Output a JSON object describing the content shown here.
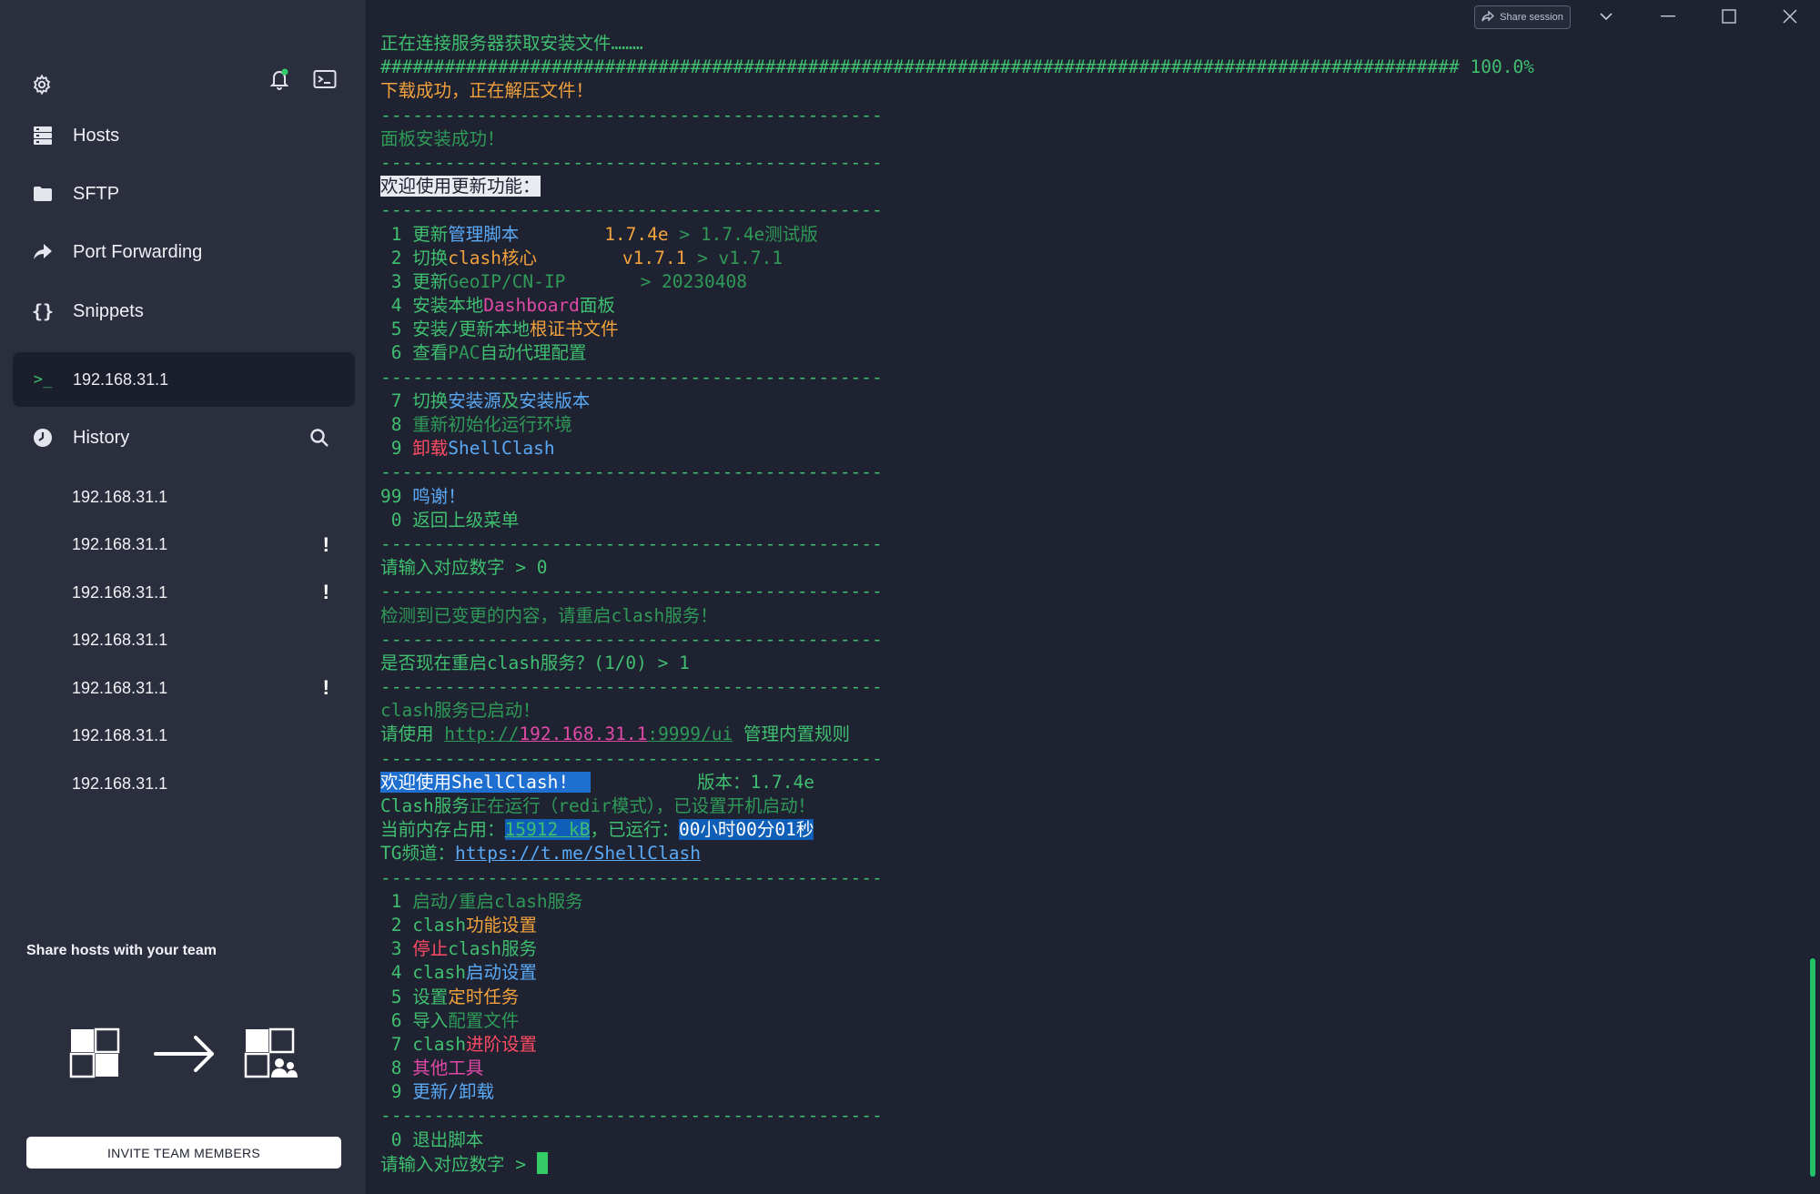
{
  "sidebar": {
    "nav": [
      {
        "label": "Hosts",
        "icon": "hosts-icon"
      },
      {
        "label": "SFTP",
        "icon": "folder-icon"
      },
      {
        "label": "Port Forwarding",
        "icon": "port-forward-icon"
      },
      {
        "label": "Snippets",
        "icon": "braces-icon"
      }
    ],
    "active_session": "192.168.31.1",
    "history_label": "History",
    "history": [
      {
        "host": "192.168.31.1",
        "warn": ""
      },
      {
        "host": "192.168.31.1",
        "warn": "!"
      },
      {
        "host": "192.168.31.1",
        "warn": "!"
      },
      {
        "host": "192.168.31.1",
        "warn": ""
      },
      {
        "host": "192.168.31.1",
        "warn": "!"
      },
      {
        "host": "192.168.31.1",
        "warn": ""
      },
      {
        "host": "192.168.31.1",
        "warn": ""
      }
    ],
    "promo_title": "Share hosts with your team",
    "invite_label": "INVITE TEAM MEMBERS"
  },
  "titlebar": {
    "share_label": "Share session"
  },
  "terminal": {
    "lines": [
      [
        {
          "t": "正在连接服务器获取安装文件………",
          "c": "g"
        }
      ],
      [
        {
          "t": "##################################################################################################### 100.0%",
          "c": "g"
        }
      ],
      [
        {
          "t": "下载成功，正在解压文件！",
          "c": "o"
        }
      ],
      [
        {
          "t": "-----------------------------------------------",
          "c": "g"
        }
      ],
      [
        {
          "t": "面板安装成功！",
          "c": "gd"
        }
      ],
      [
        {
          "t": "-----------------------------------------------",
          "c": "g"
        }
      ],
      [
        {
          "t": "欢迎使用更新功能：",
          "c": "hlw"
        }
      ],
      [
        {
          "t": "-----------------------------------------------",
          "c": "g"
        }
      ],
      [
        {
          "t": " 1 ",
          "c": "g"
        },
        {
          "t": "更新",
          "c": "g"
        },
        {
          "t": "管理脚本",
          "c": "b"
        },
        {
          "t": "        ",
          "c": "g"
        },
        {
          "t": "1.7.4e",
          "c": "o"
        },
        {
          "t": " > 1.7.4e测试版",
          "c": "gd"
        }
      ],
      [
        {
          "t": " 2 ",
          "c": "g"
        },
        {
          "t": "切换",
          "c": "g"
        },
        {
          "t": "clash核心",
          "c": "o"
        },
        {
          "t": "        ",
          "c": "g"
        },
        {
          "t": "v1.7.1",
          "c": "o"
        },
        {
          "t": " > v1.7.1",
          "c": "gd"
        }
      ],
      [
        {
          "t": " 3 ",
          "c": "g"
        },
        {
          "t": "更新",
          "c": "g"
        },
        {
          "t": "GeoIP/CN-IP",
          "c": "gd"
        },
        {
          "t": "       > 20230408",
          "c": "gd"
        }
      ],
      [
        {
          "t": " 4 ",
          "c": "g"
        },
        {
          "t": "安装本地",
          "c": "g"
        },
        {
          "t": "Dashboard",
          "c": "m"
        },
        {
          "t": "面板",
          "c": "g"
        }
      ],
      [
        {
          "t": " 5 ",
          "c": "g"
        },
        {
          "t": "安装/更新本地",
          "c": "g"
        },
        {
          "t": "根证书文件",
          "c": "o"
        }
      ],
      [
        {
          "t": " 6 ",
          "c": "g"
        },
        {
          "t": "查看",
          "c": "g"
        },
        {
          "t": "PAC",
          "c": "gd"
        },
        {
          "t": "自动代理配置",
          "c": "g"
        }
      ],
      [
        {
          "t": "-----------------------------------------------",
          "c": "g"
        }
      ],
      [
        {
          "t": " 7 ",
          "c": "g"
        },
        {
          "t": "切换",
          "c": "g"
        },
        {
          "t": "安装源",
          "c": "b"
        },
        {
          "t": "及",
          "c": "g"
        },
        {
          "t": "安装版本",
          "c": "b"
        }
      ],
      [
        {
          "t": " 8 ",
          "c": "g"
        },
        {
          "t": "重新初始化运行环境",
          "c": "gd"
        }
      ],
      [
        {
          "t": " 9 ",
          "c": "g"
        },
        {
          "t": "卸载",
          "c": "r"
        },
        {
          "t": "ShellClash",
          "c": "b"
        }
      ],
      [
        {
          "t": "-----------------------------------------------",
          "c": "g"
        }
      ],
      [
        {
          "t": "99 ",
          "c": "g"
        },
        {
          "t": "鸣谢！",
          "c": "b"
        }
      ],
      [
        {
          "t": " 0 ",
          "c": "g"
        },
        {
          "t": "返回上级菜单",
          "c": "g"
        }
      ],
      [
        {
          "t": "-----------------------------------------------",
          "c": "g"
        }
      ],
      [
        {
          "t": "请输入对应数字 > 0",
          "c": "g"
        }
      ],
      [
        {
          "t": "-----------------------------------------------",
          "c": "g"
        }
      ],
      [
        {
          "t": "检测到已变更的内容，请重启clash服务！",
          "c": "gd"
        }
      ],
      [
        {
          "t": "-----------------------------------------------",
          "c": "g"
        }
      ],
      [
        {
          "t": "是否现在重启clash服务？(1/0) > 1",
          "c": "g"
        }
      ],
      [
        {
          "t": "-----------------------------------------------",
          "c": "g"
        }
      ],
      [
        {
          "t": "clash服务已启动！",
          "c": "gd"
        }
      ],
      [
        {
          "t": "请使用 ",
          "c": "g"
        },
        {
          "t": "http://",
          "c": "gd u"
        },
        {
          "t": "192.168.31.1",
          "c": "m u"
        },
        {
          "t": ":9999/ui",
          "c": "gd u"
        },
        {
          "t": " 管理内置规则",
          "c": "g"
        }
      ],
      [
        {
          "t": "-----------------------------------------------",
          "c": "g"
        }
      ],
      [
        {
          "t": "欢迎使用ShellClash!  ",
          "c": "hlb"
        },
        {
          "t": "          版本：1.7.4e",
          "c": "g"
        }
      ],
      [
        {
          "t": "Clash服务",
          "c": "g"
        },
        {
          "t": "正在运行（redir模式）",
          "c": "gd"
        },
        {
          "t": "，已设置开机启动！",
          "c": "gd"
        }
      ],
      [
        {
          "t": "当前内存占用：",
          "c": "g"
        },
        {
          "t": "15912 kB",
          "c": "hlg"
        },
        {
          "t": "，已运行：",
          "c": "g"
        },
        {
          "t": "00小时00分01秒",
          "c": "hlb2"
        }
      ],
      [
        {
          "t": "TG频道：",
          "c": "g"
        },
        {
          "t": "https://t.me/ShellClash",
          "c": "b u"
        }
      ],
      [
        {
          "t": "-----------------------------------------------",
          "c": "g"
        }
      ],
      [
        {
          "t": " 1 ",
          "c": "g"
        },
        {
          "t": "启动/重启clash服务",
          "c": "gd"
        }
      ],
      [
        {
          "t": " 2 ",
          "c": "g"
        },
        {
          "t": "clash",
          "c": "g"
        },
        {
          "t": "功能设置",
          "c": "o"
        }
      ],
      [
        {
          "t": " 3 ",
          "c": "g"
        },
        {
          "t": "停止",
          "c": "r"
        },
        {
          "t": "clash服务",
          "c": "g"
        }
      ],
      [
        {
          "t": " 4 ",
          "c": "g"
        },
        {
          "t": "clash",
          "c": "g"
        },
        {
          "t": "启动设置",
          "c": "b"
        }
      ],
      [
        {
          "t": " 5 ",
          "c": "g"
        },
        {
          "t": "设置",
          "c": "g"
        },
        {
          "t": "定时任务",
          "c": "o"
        }
      ],
      [
        {
          "t": " 6 ",
          "c": "g"
        },
        {
          "t": "导入",
          "c": "g"
        },
        {
          "t": "配置文件",
          "c": "gd"
        }
      ],
      [
        {
          "t": " 7 ",
          "c": "g"
        },
        {
          "t": "clash",
          "c": "g"
        },
        {
          "t": "进阶设置",
          "c": "r"
        }
      ],
      [
        {
          "t": " 8 ",
          "c": "g"
        },
        {
          "t": "其他工具",
          "c": "m"
        }
      ],
      [
        {
          "t": " 9 ",
          "c": "g"
        },
        {
          "t": "更新/卸载",
          "c": "b"
        }
      ],
      [
        {
          "t": "-----------------------------------------------",
          "c": "g"
        }
      ],
      [
        {
          "t": " 0 ",
          "c": "g"
        },
        {
          "t": "退出脚本",
          "c": "g"
        }
      ],
      [
        {
          "t": "请输入对应数字 > ",
          "c": "g"
        }
      ]
    ]
  }
}
